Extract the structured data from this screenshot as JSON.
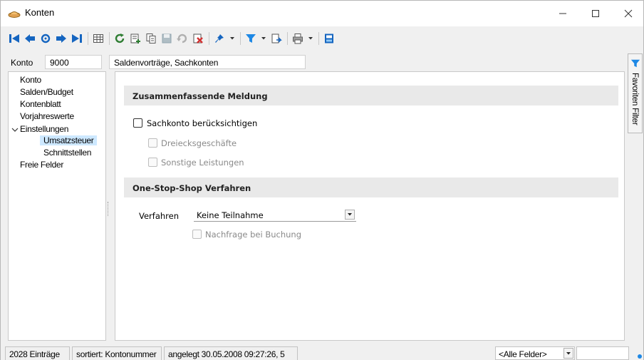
{
  "window": {
    "title": "Konten",
    "icons": [
      "app-icon",
      "minimize-icon",
      "maximize-icon",
      "close-icon"
    ]
  },
  "toolbar": {
    "buttons": [
      "first-record-icon",
      "previous-record-icon",
      "search-record-icon",
      "next-record-icon",
      "last-record-icon",
      "table-view-icon",
      "refresh-icon",
      "new-record-icon",
      "copy-record-icon",
      "save-icon",
      "undo-icon",
      "delete-icon",
      "pin-icon",
      "filter-icon",
      "export-icon",
      "print-icon",
      "layout-icon"
    ]
  },
  "konto": {
    "label": "Konto",
    "value": "9000",
    "description": "Saldenvorträge, Sachkonten"
  },
  "tree": {
    "items": [
      {
        "label": "Konto"
      },
      {
        "label": "Salden/Budget"
      },
      {
        "label": "Kontenblatt"
      },
      {
        "label": "Vorjahreswerte"
      },
      {
        "label": "Einstellungen",
        "expanded": true
      },
      {
        "label": "Umsatzsteuer",
        "selected": true
      },
      {
        "label": "Schnittstellen"
      },
      {
        "label": "Freie Felder"
      }
    ]
  },
  "main": {
    "zm": {
      "header": "Zusammenfassende Meldung",
      "sachkonto_label": "Sachkonto berücksichtigen",
      "sachkonto_checked": false,
      "dreiecks_label": "Dreiecksgeschäfte",
      "dreiecks_checked": false,
      "sonstige_label": "Sonstige Leistungen",
      "sonstige_checked": false
    },
    "oss": {
      "header": "One-Stop-Shop Verfahren",
      "verfahren_label": "Verfahren",
      "verfahren_value": "Keine Teilnahme",
      "nachfrage_label": "Nachfrage bei Buchung",
      "nachfrage_checked": false
    }
  },
  "sidetab": {
    "label": "Favoriten Filter"
  },
  "statusbar": {
    "count": "2028 Einträge",
    "sorted": "sortiert: Kontonummer",
    "created": "angelegt 30.05.2008 09:27:26,",
    "created_suffix": "5",
    "filter_value": "<Alle Felder>"
  },
  "colors": {
    "accent_blue": "#1565c0",
    "selected_bg": "#cde8ff",
    "section_bg": "#e9e9e9",
    "delete_red": "#d32f2f",
    "refresh_green": "#2e7d32"
  }
}
